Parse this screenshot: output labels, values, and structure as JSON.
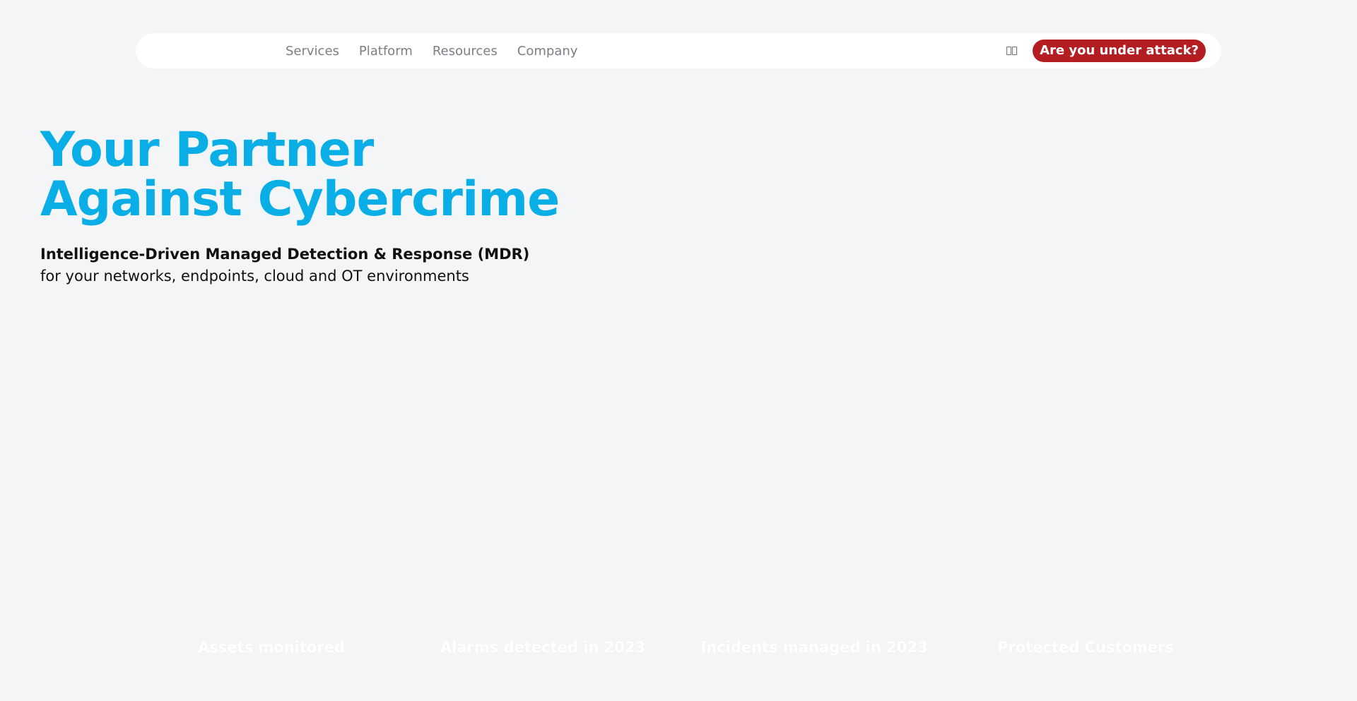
{
  "nav": {
    "links": [
      "Services",
      "Platform",
      "Resources",
      "Company"
    ],
    "lang_icon": "language-toggle-icon",
    "cta_label": "Are you under attack?"
  },
  "hero": {
    "title_line1": "Your Partner",
    "title_line2": "Against Cybercrime",
    "subtitle_bold": "Intelligence-Driven Managed Detection & Response (MDR)",
    "subtitle": "for your networks, endpoints, cloud and OT environments"
  },
  "stats": {
    "labels": [
      "Assets monitored",
      "Alarms detected in 2023",
      "Incidents managed in 2023",
      "Protected Customers"
    ]
  },
  "colors": {
    "background": "#f4f5f7",
    "accent": "#0aaee7",
    "cta": "#b41d22",
    "nav_text": "#7a7f86"
  }
}
